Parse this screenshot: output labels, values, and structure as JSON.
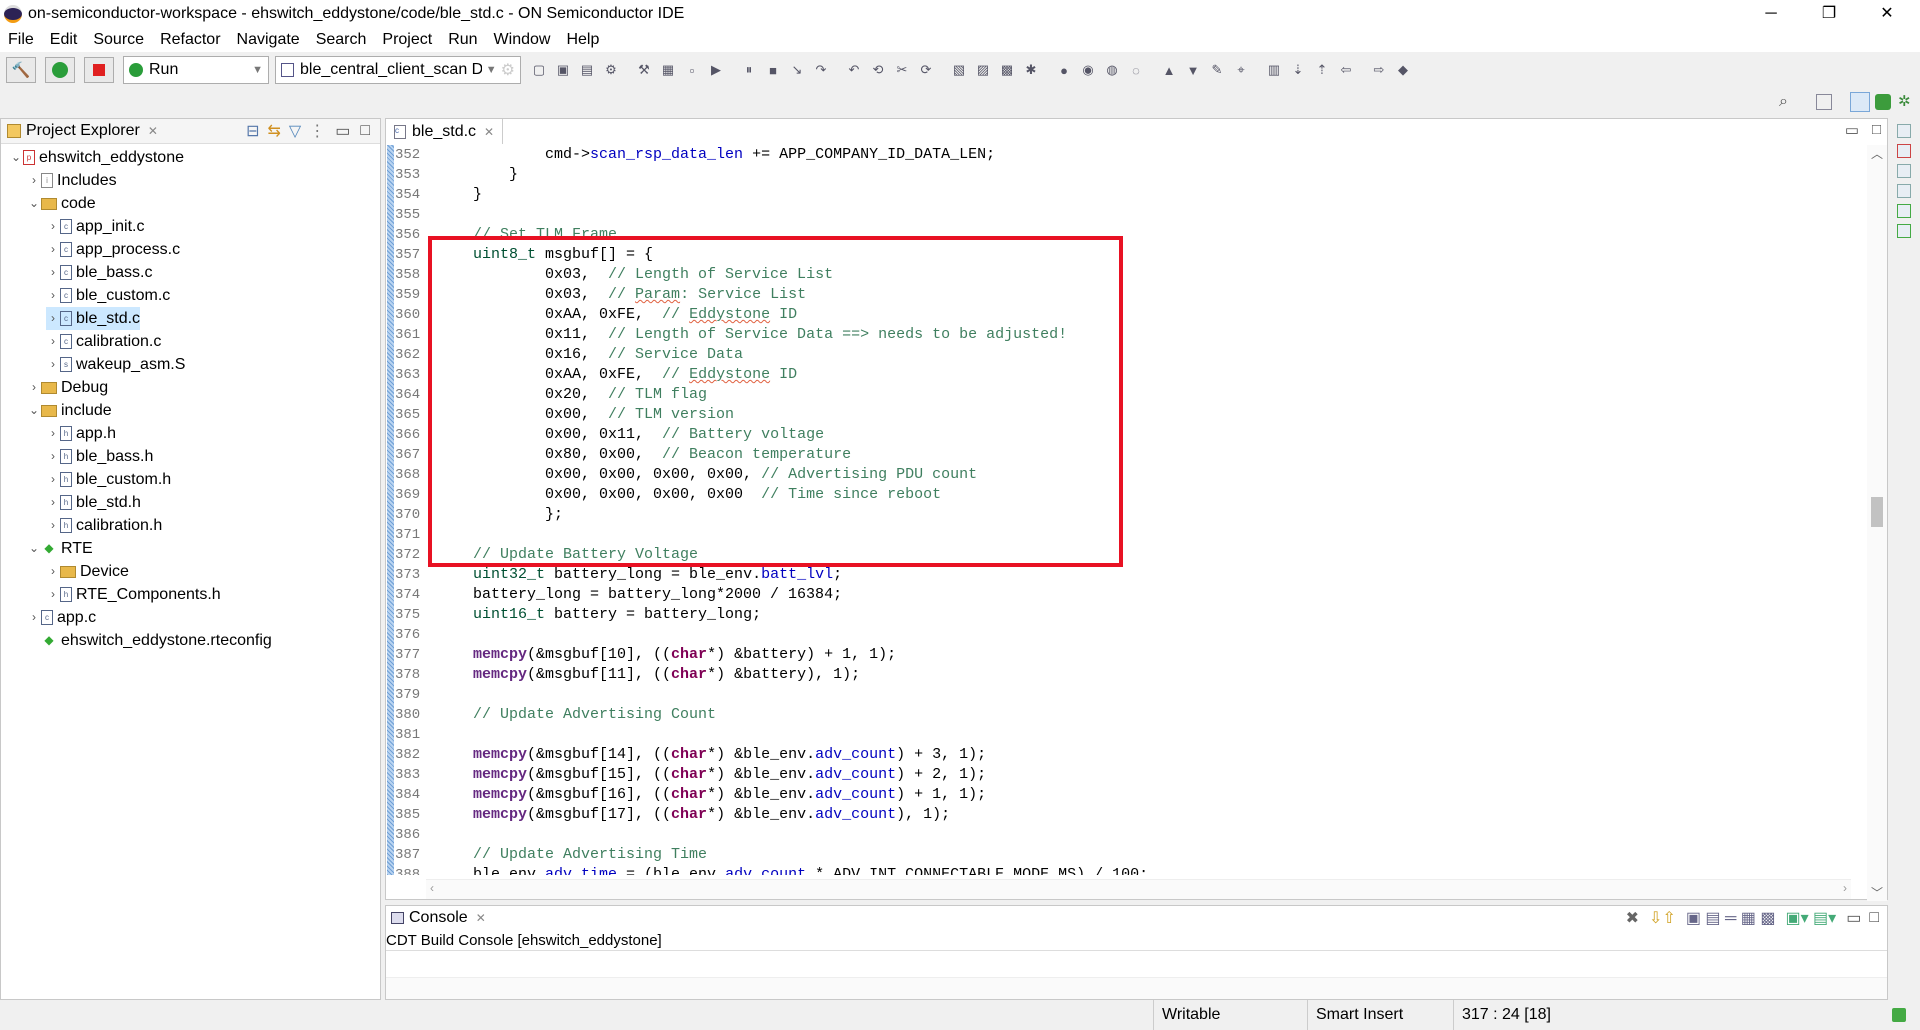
{
  "window": {
    "title": "on-semiconductor-workspace - ehswitch_eddystone/code/ble_std.c - ON Semiconductor IDE",
    "minimize": "─",
    "restore": "❐",
    "close": "✕"
  },
  "menu": [
    "File",
    "Edit",
    "Source",
    "Refactor",
    "Navigate",
    "Search",
    "Project",
    "Run",
    "Window",
    "Help"
  ],
  "toolbar": {
    "run_config": "Run",
    "launch_target": "ble_central_client_scan D",
    "icons": [
      "build-icon",
      "run-icon",
      "stop-icon",
      "new-icon",
      "save-icon",
      "save-all-icon",
      "debug-icon",
      "tools-icon",
      "terminal-icon",
      "resume-icon",
      "suspend-icon",
      "terminate-icon",
      "step-into-icon",
      "step-over-icon",
      "step-return-icon",
      "refresh-icon",
      "external-tools-icon",
      "new-project-icon",
      "new-class-icon",
      "new-folder-icon",
      "new-file-icon",
      "bug-icon",
      "run-menu-icon",
      "coverage-icon",
      "profile-icon",
      "open-type-icon",
      "open-resource-icon",
      "search-icon",
      "annotation-icon",
      "mark-occurrences-icon",
      "block-select-icon",
      "show-whitespace-icon",
      "next-annotation-icon",
      "prev-annotation-icon",
      "back-icon",
      "forward-icon",
      "pin-icon"
    ]
  },
  "explorer": {
    "title": "Project Explorer",
    "tree": [
      {
        "label": "ehswitch_eddystone",
        "level": 0,
        "chev": "open",
        "icon": "project"
      },
      {
        "label": "Includes",
        "level": 1,
        "chev": "closed",
        "icon": "includes"
      },
      {
        "label": "code",
        "level": 1,
        "chev": "open",
        "icon": "folder"
      },
      {
        "label": "app_init.c",
        "level": 2,
        "chev": "closed",
        "icon": "c-file"
      },
      {
        "label": "app_process.c",
        "level": 2,
        "chev": "closed",
        "icon": "c-file"
      },
      {
        "label": "ble_bass.c",
        "level": 2,
        "chev": "closed",
        "icon": "c-file"
      },
      {
        "label": "ble_custom.c",
        "level": 2,
        "chev": "closed",
        "icon": "c-file"
      },
      {
        "label": "ble_std.c",
        "level": 2,
        "chev": "closed",
        "icon": "c-file",
        "selected": true
      },
      {
        "label": "calibration.c",
        "level": 2,
        "chev": "closed",
        "icon": "c-file"
      },
      {
        "label": "wakeup_asm.S",
        "level": 2,
        "chev": "closed",
        "icon": "s-file"
      },
      {
        "label": "Debug",
        "level": 1,
        "chev": "closed",
        "icon": "folder"
      },
      {
        "label": "include",
        "level": 1,
        "chev": "open",
        "icon": "folder"
      },
      {
        "label": "app.h",
        "level": 2,
        "chev": "closed",
        "icon": "h-file"
      },
      {
        "label": "ble_bass.h",
        "level": 2,
        "chev": "closed",
        "icon": "h-file"
      },
      {
        "label": "ble_custom.h",
        "level": 2,
        "chev": "closed",
        "icon": "h-file"
      },
      {
        "label": "ble_std.h",
        "level": 2,
        "chev": "closed",
        "icon": "h-file"
      },
      {
        "label": "calibration.h",
        "level": 2,
        "chev": "closed",
        "icon": "h-file"
      },
      {
        "label": "RTE",
        "level": 1,
        "chev": "open",
        "icon": "rte"
      },
      {
        "label": "Device",
        "level": 2,
        "chev": "closed",
        "icon": "folder"
      },
      {
        "label": "RTE_Components.h",
        "level": 2,
        "chev": "closed",
        "icon": "h-file"
      },
      {
        "label": "app.c",
        "level": 1,
        "chev": "closed",
        "icon": "c-file"
      },
      {
        "label": "ehswitch_eddystone.rteconfig",
        "level": 1,
        "chev": "none",
        "icon": "rteconfig"
      }
    ]
  },
  "editor": {
    "tab": "ble_std.c",
    "lines": [
      {
        "n": "352",
        "s": [
          [
            "t",
            "            cmd->"
          ],
          [
            "f",
            "scan_rsp_data_len"
          ],
          [
            "t",
            " += APP_COMPANY_ID_DATA_LEN;"
          ]
        ]
      },
      {
        "n": "353",
        "s": [
          [
            "t",
            "        }"
          ]
        ]
      },
      {
        "n": "354",
        "s": [
          [
            "t",
            "    }"
          ]
        ]
      },
      {
        "n": "355",
        "s": []
      },
      {
        "n": "356",
        "s": [
          [
            "c",
            "    // Set TLM Frame"
          ]
        ]
      },
      {
        "n": "357",
        "s": [
          [
            "ty",
            "    uint8_t"
          ],
          [
            "t",
            " msgbuf[] = {"
          ]
        ]
      },
      {
        "n": "358",
        "s": [
          [
            "t",
            "            0x03,  "
          ],
          [
            "c",
            "// Length of Service List"
          ]
        ]
      },
      {
        "n": "359",
        "s": [
          [
            "t",
            "            0x03,  "
          ],
          [
            "c",
            "// "
          ],
          [
            "sp",
            "Param"
          ],
          [
            "c",
            ": Service List"
          ]
        ]
      },
      {
        "n": "360",
        "s": [
          [
            "t",
            "            0xAA, 0xFE,  "
          ],
          [
            "c",
            "// "
          ],
          [
            "sp",
            "Eddystone"
          ],
          [
            "c",
            " ID"
          ]
        ]
      },
      {
        "n": "361",
        "s": [
          [
            "t",
            "            0x11,  "
          ],
          [
            "c",
            "// Length of Service Data ==> needs to be adjusted!"
          ]
        ]
      },
      {
        "n": "362",
        "s": [
          [
            "t",
            "            0x16,  "
          ],
          [
            "c",
            "// Service Data"
          ]
        ]
      },
      {
        "n": "363",
        "s": [
          [
            "t",
            "            0xAA, 0xFE,  "
          ],
          [
            "c",
            "// "
          ],
          [
            "sp",
            "Eddystone"
          ],
          [
            "c",
            " ID"
          ]
        ]
      },
      {
        "n": "364",
        "s": [
          [
            "t",
            "            0x20,  "
          ],
          [
            "c",
            "// TLM flag"
          ]
        ]
      },
      {
        "n": "365",
        "s": [
          [
            "t",
            "            0x00,  "
          ],
          [
            "c",
            "// TLM version"
          ]
        ]
      },
      {
        "n": "366",
        "s": [
          [
            "t",
            "            0x00, 0x11,  "
          ],
          [
            "c",
            "// Battery voltage"
          ]
        ]
      },
      {
        "n": "367",
        "s": [
          [
            "t",
            "            0x80, 0x00,  "
          ],
          [
            "c",
            "// Beacon temperature"
          ]
        ]
      },
      {
        "n": "368",
        "s": [
          [
            "t",
            "            0x00, 0x00, 0x00, 0x00, "
          ],
          [
            "c",
            "// Advertising PDU count"
          ]
        ]
      },
      {
        "n": "369",
        "s": [
          [
            "t",
            "            0x00, 0x00, 0x00, 0x00  "
          ],
          [
            "c",
            "// Time since reboot"
          ]
        ]
      },
      {
        "n": "370",
        "s": [
          [
            "t",
            "            };"
          ]
        ]
      },
      {
        "n": "371",
        "s": []
      },
      {
        "n": "372",
        "s": [
          [
            "c",
            "    // Update Battery Voltage"
          ]
        ]
      },
      {
        "n": "373",
        "s": [
          [
            "ty",
            "    uint32_t"
          ],
          [
            "t",
            " battery_long = ble_env."
          ],
          [
            "f",
            "batt_lvl"
          ],
          [
            "t",
            ";"
          ]
        ]
      },
      {
        "n": "374",
        "s": [
          [
            "t",
            "    battery_long = battery_long*2000 / 16384;"
          ]
        ]
      },
      {
        "n": "375",
        "s": [
          [
            "ty",
            "    uint16_t"
          ],
          [
            "t",
            " battery = battery_long;"
          ]
        ]
      },
      {
        "n": "376",
        "s": []
      },
      {
        "n": "377",
        "s": [
          [
            "m",
            "    memcpy"
          ],
          [
            "t",
            "(&msgbuf[10], (("
          ],
          [
            "k",
            "char"
          ],
          [
            "t",
            "*) &battery) + 1, 1);"
          ]
        ]
      },
      {
        "n": "378",
        "s": [
          [
            "m",
            "    memcpy"
          ],
          [
            "t",
            "(&msgbuf[11], (("
          ],
          [
            "k",
            "char"
          ],
          [
            "t",
            "*) &battery), 1);"
          ]
        ]
      },
      {
        "n": "379",
        "s": []
      },
      {
        "n": "380",
        "s": [
          [
            "c",
            "    // Update Advertising Count"
          ]
        ]
      },
      {
        "n": "381",
        "s": []
      },
      {
        "n": "382",
        "s": [
          [
            "m",
            "    memcpy"
          ],
          [
            "t",
            "(&msgbuf[14], (("
          ],
          [
            "k",
            "char"
          ],
          [
            "t",
            "*) &ble_env."
          ],
          [
            "f",
            "adv_count"
          ],
          [
            "t",
            ") + 3, 1);"
          ]
        ]
      },
      {
        "n": "383",
        "s": [
          [
            "m",
            "    memcpy"
          ],
          [
            "t",
            "(&msgbuf[15], (("
          ],
          [
            "k",
            "char"
          ],
          [
            "t",
            "*) &ble_env."
          ],
          [
            "f",
            "adv_count"
          ],
          [
            "t",
            ") + 2, 1);"
          ]
        ]
      },
      {
        "n": "384",
        "s": [
          [
            "m",
            "    memcpy"
          ],
          [
            "t",
            "(&msgbuf[16], (("
          ],
          [
            "k",
            "char"
          ],
          [
            "t",
            "*) &ble_env."
          ],
          [
            "f",
            "adv_count"
          ],
          [
            "t",
            ") + 1, 1);"
          ]
        ]
      },
      {
        "n": "385",
        "s": [
          [
            "m",
            "    memcpy"
          ],
          [
            "t",
            "(&msgbuf[17], (("
          ],
          [
            "k",
            "char"
          ],
          [
            "t",
            "*) &ble_env."
          ],
          [
            "f",
            "adv_count"
          ],
          [
            "t",
            "), 1);"
          ]
        ]
      },
      {
        "n": "386",
        "s": []
      },
      {
        "n": "387",
        "s": [
          [
            "c",
            "    // Update Advertising Time"
          ]
        ]
      },
      {
        "n": "388",
        "s": [
          [
            "t",
            "    ble_env."
          ],
          [
            "f",
            "adv_time"
          ],
          [
            "t",
            " = (ble_env."
          ],
          [
            "f",
            "adv_count"
          ],
          [
            "t",
            " * ADV_INT_CONNECTABLE_MODE_MS) / 100;"
          ]
        ]
      }
    ]
  },
  "console": {
    "title": "Console",
    "content": "CDT Build Console [ehswitch_eddystone]"
  },
  "status": {
    "writable": "Writable",
    "insert_mode": "Smart Insert",
    "position": "317 : 24 [18]"
  },
  "colors": {
    "highlight_box": "#e81123",
    "selection": "#cce8ff"
  }
}
